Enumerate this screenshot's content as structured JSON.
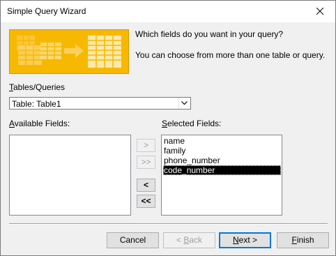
{
  "window": {
    "title": "Simple Query Wizard"
  },
  "intro": {
    "question": "Which fields do you want in your query?",
    "hint": "You can choose from more than one table or query."
  },
  "tables_queries": {
    "label_accel": "T",
    "label_rest": "ables/Queries",
    "selected": "Table: Table1"
  },
  "available_fields": {
    "label_accel": "A",
    "label_rest": "vailable Fields:",
    "items": []
  },
  "selected_fields": {
    "label_accel": "S",
    "label_rest": "elected Fields:",
    "items": [
      "name",
      "family",
      "phone_number",
      "code_number"
    ],
    "selected_index": 3
  },
  "move_buttons": {
    "add_one": ">",
    "add_all": ">>",
    "remove_one": "<",
    "remove_all": "<<"
  },
  "buttons": {
    "cancel": "Cancel",
    "back_prefix": "< ",
    "back_accel": "B",
    "back_rest": "ack",
    "next_accel": "N",
    "next_rest": "ext >",
    "finish_accel": "F",
    "finish_rest": "inish"
  },
  "icons": {
    "close": "close-icon",
    "dropdown": "chevron-down-icon",
    "banner": "wizard-banner-illustration"
  },
  "colors": {
    "banner_bg": "#f7b801",
    "default_button_border": "#0078d7",
    "selection_bg": "#000000"
  }
}
